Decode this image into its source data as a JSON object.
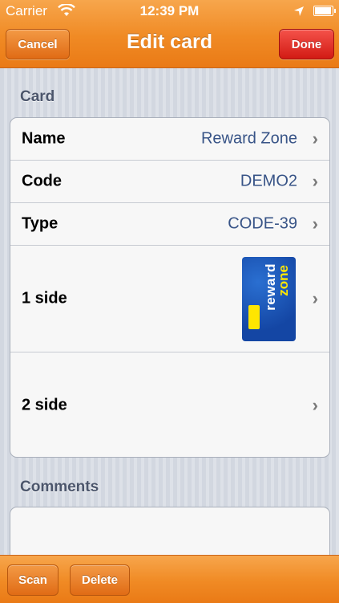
{
  "status_bar": {
    "carrier": "Carrier",
    "time": "12:39 PM",
    "battery_level": 0.95,
    "icons": [
      "wifi-icon",
      "location-arrow-icon",
      "battery-icon"
    ]
  },
  "nav": {
    "title": "Edit card",
    "cancel_label": "Cancel",
    "done_label": "Done"
  },
  "card_section": {
    "header": "Card",
    "rows": [
      {
        "label": "Name",
        "value": "Reward Zone"
      },
      {
        "label": "Code",
        "value": "DEMO2"
      },
      {
        "label": "Type",
        "value": "CODE-39"
      },
      {
        "label": "1 side",
        "value": ""
      },
      {
        "label": "2 side",
        "value": ""
      }
    ],
    "card_image": {
      "text_line1": "reward",
      "text_line2": "zone"
    }
  },
  "comments_section": {
    "header": "Comments",
    "value": ""
  },
  "toolbar": {
    "scan_label": "Scan",
    "delete_label": "Delete"
  },
  "colors": {
    "bar_orange": "#f08a24",
    "done_red": "#d21b14",
    "value_blue": "#385487",
    "header_gray": "#4c566c"
  }
}
